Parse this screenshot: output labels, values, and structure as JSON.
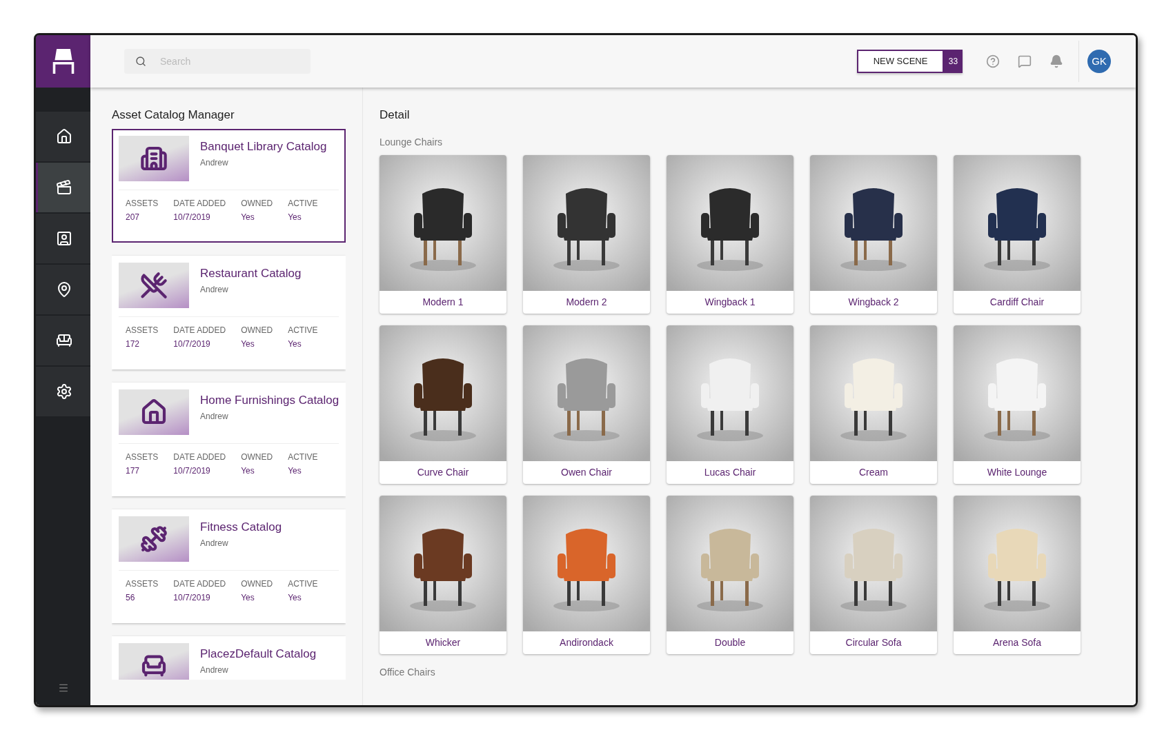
{
  "sidebar": {
    "items": [
      {
        "kind": "home",
        "selected": false
      },
      {
        "kind": "scenes",
        "selected": true
      },
      {
        "kind": "contacts",
        "selected": false
      },
      {
        "kind": "places",
        "selected": false
      },
      {
        "kind": "furniture",
        "selected": false
      },
      {
        "kind": "settings",
        "selected": false
      }
    ]
  },
  "topbar": {
    "search": {
      "placeholder": "Search"
    },
    "new_scene": {
      "label": "NEW SCENE",
      "count": "33"
    },
    "avatar": "GK"
  },
  "catalog_panel": {
    "title": "Asset Catalog Manager",
    "catalogs": [
      {
        "kind": "banquet",
        "title": "Banquet Library Catalog",
        "author": "Andrew",
        "selected": true,
        "stats": [
          {
            "label": "ASSETS",
            "value": "207"
          },
          {
            "label": "DATE ADDED",
            "value": "10/7/2019"
          },
          {
            "label": "OWNED",
            "value": "Yes"
          },
          {
            "label": "ACTIVE",
            "value": "Yes"
          }
        ]
      },
      {
        "kind": "restaurant",
        "title": "Restaurant Catalog",
        "author": "Andrew",
        "selected": false,
        "stats": [
          {
            "label": "ASSETS",
            "value": "172"
          },
          {
            "label": "DATE ADDED",
            "value": "10/7/2019"
          },
          {
            "label": "OWNED",
            "value": "Yes"
          },
          {
            "label": "ACTIVE",
            "value": "Yes"
          }
        ]
      },
      {
        "kind": "home",
        "title": "Home Furnishings Catalog",
        "author": "Andrew",
        "selected": false,
        "stats": [
          {
            "label": "ASSETS",
            "value": "177"
          },
          {
            "label": "DATE ADDED",
            "value": "10/7/2019"
          },
          {
            "label": "OWNED",
            "value": "Yes"
          },
          {
            "label": "ACTIVE",
            "value": "Yes"
          }
        ]
      },
      {
        "kind": "fitness",
        "title": "Fitness Catalog",
        "author": "Andrew",
        "selected": false,
        "stats": [
          {
            "label": "ASSETS",
            "value": "56"
          },
          {
            "label": "DATE ADDED",
            "value": "10/7/2019"
          },
          {
            "label": "OWNED",
            "value": "Yes"
          },
          {
            "label": "ACTIVE",
            "value": "Yes"
          }
        ]
      },
      {
        "kind": "default",
        "title": "PlacezDefault Catalog",
        "author": "Andrew",
        "selected": false
      }
    ]
  },
  "detail": {
    "title": "Detail",
    "sections": [
      {
        "title": "Lounge Chairs",
        "items": [
          {
            "name": "Modern 1",
            "kind": "picture"
          },
          {
            "name": "Modern 2",
            "kind": "picture"
          },
          {
            "name": "Wingback 1",
            "kind": "picture"
          },
          {
            "name": "Wingback 2",
            "kind": "picture"
          },
          {
            "name": "Cardiff Chair",
            "kind": "picture"
          },
          {
            "name": "Curve Chair",
            "kind": "picture"
          },
          {
            "name": "Owen Chair",
            "kind": "picture"
          },
          {
            "name": "Lucas Chair",
            "kind": "picture"
          },
          {
            "name": "Cream",
            "kind": "picture"
          },
          {
            "name": "White Lounge",
            "kind": "picture"
          },
          {
            "name": "Whicker",
            "kind": "picture"
          },
          {
            "name": "Andirondack",
            "kind": "picture"
          },
          {
            "name": "Double",
            "kind": "picture"
          },
          {
            "name": "Circular Sofa",
            "kind": "picture"
          },
          {
            "name": "Arena Sofa",
            "kind": "picture"
          }
        ]
      },
      {
        "title": "Office Chairs"
      }
    ]
  }
}
